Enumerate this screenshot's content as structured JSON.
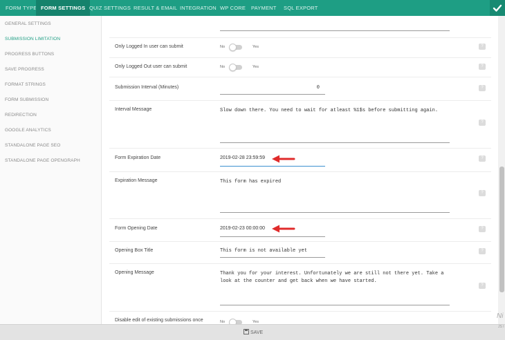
{
  "tabs": [
    {
      "label": "FORM TYPE"
    },
    {
      "label": "FORM SETTINGS"
    },
    {
      "label": "QUIZ SETTINGS"
    },
    {
      "label": "RESULT & EMAIL"
    },
    {
      "label": "INTEGRATION"
    },
    {
      "label": "WP CORE"
    },
    {
      "label": "PAYMENT"
    },
    {
      "label": "SQL EXPORT"
    }
  ],
  "active_tab": "FORM SETTINGS",
  "sidebar": {
    "items": [
      {
        "label": "GENERAL SETTINGS"
      },
      {
        "label": "SUBMISSION LIMITATION"
      },
      {
        "label": "PROGRESS BUTTONS"
      },
      {
        "label": "SAVE PROGRESS"
      },
      {
        "label": "FORMAT STRINGS"
      },
      {
        "label": "FORM SUBMISSION"
      },
      {
        "label": "REDIRECTION"
      },
      {
        "label": "GOOGLE ANALYTICS"
      },
      {
        "label": "STANDALONE PAGE SEO"
      },
      {
        "label": "STANDALONE PAGE OPENGRAPH"
      }
    ],
    "active": "SUBMISSION LIMITATION"
  },
  "settings": {
    "logged_in_only": {
      "label": "Only Logged In user can submit",
      "off_label": "No",
      "on_label": "Yes",
      "value": false
    },
    "logged_out_only": {
      "label": "Only Logged Out user can submit",
      "off_label": "No",
      "on_label": "Yes",
      "value": false
    },
    "interval": {
      "label": "Submission Interval (Minutes)",
      "value": "0"
    },
    "interval_message": {
      "label": "Interval Message",
      "value": "Slow down there. You need to wait for atleast %1$s before submitting again."
    },
    "expiration_date": {
      "label": "Form Expiration Date",
      "value": "2019-02-28 23:59:59"
    },
    "expiration_message": {
      "label": "Expiration Message",
      "value": "This form has expired"
    },
    "opening_date": {
      "label": "Form Opening Date",
      "value": "2019-02-23 00:00:00"
    },
    "opening_title": {
      "label": "Opening Box Title",
      "value": "This form is not available yet"
    },
    "opening_message": {
      "label": "Opening Message",
      "value": "Thank you for your interest. Unfortunately we are still not there yet. Take a look at the counter and get back when we have started."
    },
    "disable_edit": {
      "label": "Disable edit of existing submissions once",
      "off_label": "No",
      "on_label": "Yes",
      "value": false
    }
  },
  "help_icon": "?",
  "footer": {
    "save_label": "SAVE"
  },
  "corner": {
    "text": "Ni",
    "sub": "JS I"
  },
  "colors": {
    "accent": "#1e9e84",
    "arrow": "#e02b2b"
  }
}
